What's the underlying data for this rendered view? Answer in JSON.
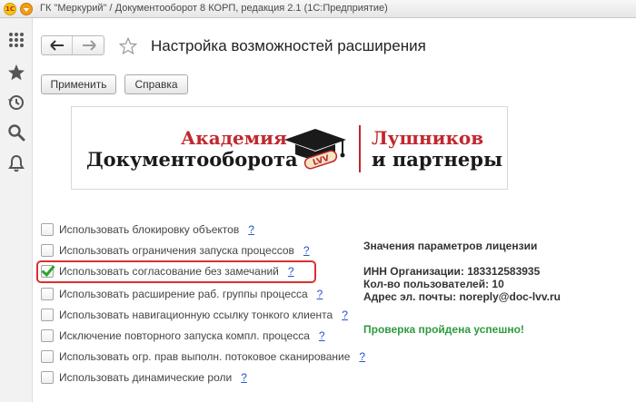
{
  "window": {
    "logo_text": "1С",
    "title": "ГК \"Меркурий\" / Документооборот 8 КОРП, редакция 2.1  (1С:Предприятие)"
  },
  "sidebar": {
    "items": [
      {
        "icon": "apps-grid-icon"
      },
      {
        "icon": "favorites-star-icon"
      },
      {
        "icon": "history-icon"
      },
      {
        "icon": "search-icon"
      },
      {
        "icon": "notifications-bell-icon"
      }
    ]
  },
  "header": {
    "title": "Настройка возможностей расширения"
  },
  "toolbar": {
    "apply_label": "Применить",
    "help_label": "Справка"
  },
  "banner": {
    "line1": "Академия",
    "line2": "Документооборота",
    "line3": "Лушников",
    "line4": "и партнеры",
    "cap_text": "LVV"
  },
  "options": [
    {
      "label": "Использовать блокировку объектов",
      "checked": false,
      "help": "?"
    },
    {
      "label": "Использовать ограничения запуска процессов",
      "checked": false,
      "help": "?"
    },
    {
      "label": "Использовать согласование без замечаний",
      "checked": true,
      "help": "?"
    },
    {
      "label": "Использовать расширение раб. группы процесса",
      "checked": false,
      "help": "?"
    },
    {
      "label": "Использовать навигационную ссылку тонкого клиента",
      "checked": false,
      "help": "?"
    },
    {
      "label": "Исключение повторного запуска компл. процесса",
      "checked": false,
      "help": "?"
    },
    {
      "label": "Использовать огр. прав выполн. потоковое сканирование",
      "checked": false,
      "help": "?"
    },
    {
      "label": "Использовать динамические роли",
      "checked": false,
      "help": "?"
    }
  ],
  "license": {
    "heading": "Значения параметров лицензии",
    "inn": "ИНН Организации: 183312583935",
    "users": "Кол-во пользователей: 10",
    "email": "Адрес эл. почты: noreply@doc-lvv.ru",
    "status": "Проверка пройдена успешно!"
  },
  "colors": {
    "accent_red": "#c1272d",
    "success_green": "#2e9a3f",
    "link_blue": "#2255cc",
    "highlight_red": "#d9302f"
  }
}
